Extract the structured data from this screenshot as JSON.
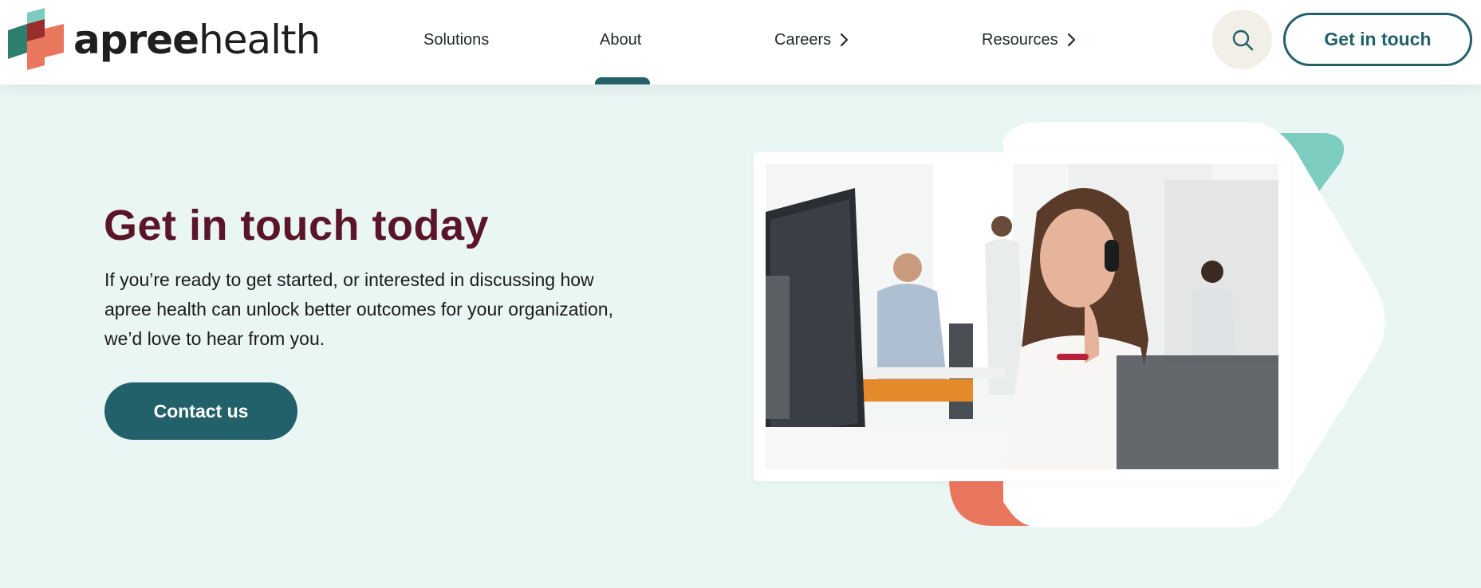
{
  "brand": {
    "name_bold": "apree",
    "name_light": "health"
  },
  "nav": {
    "items": [
      {
        "label": "Solutions"
      },
      {
        "label": "About"
      },
      {
        "label": "Careers"
      },
      {
        "label": "Resources"
      }
    ],
    "cta_label": "Get in touch"
  },
  "hero": {
    "title": "Get in touch today",
    "body": "If you’re ready to get started, or interested in discussing how apree health can unlock better outcomes for your organization, we’d love to hear from you.",
    "button_label": "Contact us"
  },
  "colors": {
    "page_bg": "#eaf6f3",
    "primary": "#22616a",
    "title": "#5a1628",
    "teal_accent": "#7ccdbf",
    "coral_accent": "#e8775d"
  }
}
